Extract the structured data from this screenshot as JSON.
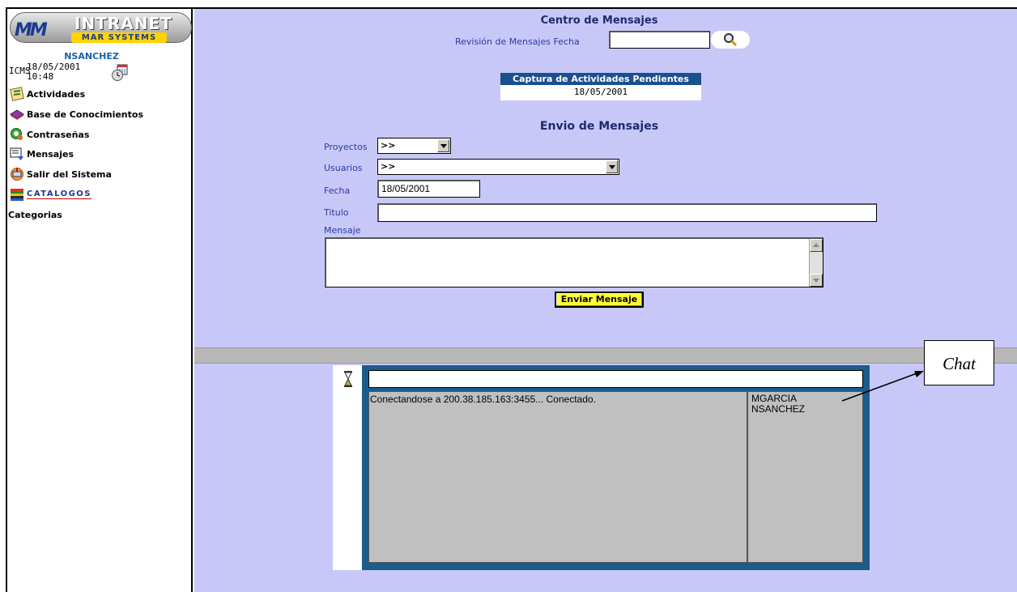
{
  "sidebar": {
    "logo_title": "INTRANET",
    "logo_subtitle": "MAR SYSTEMS",
    "username": "NSANCHEZ",
    "system": "ICMS",
    "date": "18/05/2001",
    "time": "10:48",
    "items": [
      {
        "label": "Actividades",
        "icon": "activities-icon"
      },
      {
        "label": "Base de Conocimientos",
        "icon": "knowledge-base-icon"
      },
      {
        "label": "Contraseñas",
        "icon": "passwords-icon"
      },
      {
        "label": "Mensajes",
        "icon": "messages-icon"
      },
      {
        "label": "Salir del Sistema",
        "icon": "exit-icon"
      },
      {
        "label": "CATALOGOS",
        "icon": "catalogs-icon"
      },
      {
        "label": "Categorias"
      }
    ]
  },
  "main": {
    "title": "Centro de Mensajes",
    "review_label": "Revisión de Mensajes Fecha",
    "review_value": "",
    "pending_header": "Captura de Actividades Pendientes",
    "pending_date": "18/05/2001",
    "send_title": "Envio de Mensajes",
    "proyectos_label": "Proyectos",
    "proyectos_value": ">>",
    "usuarios_label": "Usuarios",
    "usuarios_value": ">>",
    "fecha_label": "Fecha",
    "fecha_value": "18/05/2001",
    "titulo_label": "Titulo",
    "titulo_value": "",
    "mensaje_label": "Mensaje",
    "mensaje_value": "",
    "send_button": "Enviar Mensaje"
  },
  "chat": {
    "input_value": "",
    "log": "Conectandose a 200.38.185.163:3455... Conectado.",
    "users": [
      "MGARCIA",
      "NSANCHEZ"
    ],
    "callout": "Chat"
  }
}
